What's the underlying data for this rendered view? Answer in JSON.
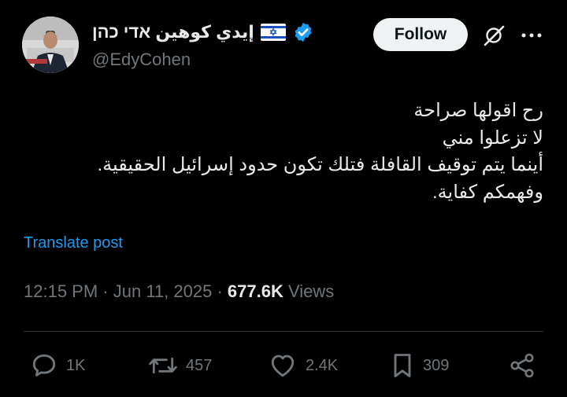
{
  "author": {
    "display_name": "إيدي كوهين אדי כהן",
    "handle": "@EdyCohen",
    "verified": true,
    "flag": "Israel"
  },
  "header_actions": {
    "follow_label": "Follow",
    "icons": [
      "grok-icon",
      "more-icon"
    ]
  },
  "tweet": {
    "lines": [
      "رح اقولها صراحة",
      "لا تزعلوا مني",
      "أينما يتم توقيف القافلة فتلك تكون حدود إسرائيل الحقيقية.",
      "وفهمكم كفاية."
    ],
    "translate_label": "Translate post"
  },
  "meta": {
    "time": "12:15 PM",
    "date": "Jun 11, 2025",
    "separator": " · ",
    "views_count": "677.6K",
    "views_label": "Views"
  },
  "actions": {
    "replies": "1K",
    "reposts": "457",
    "likes": "2.4K",
    "bookmarks": "309"
  },
  "colors": {
    "background": "#000000",
    "text": "#e7e9ea",
    "muted": "#71767b",
    "link": "#1d9bf0",
    "verified": "#1d9bf0"
  }
}
